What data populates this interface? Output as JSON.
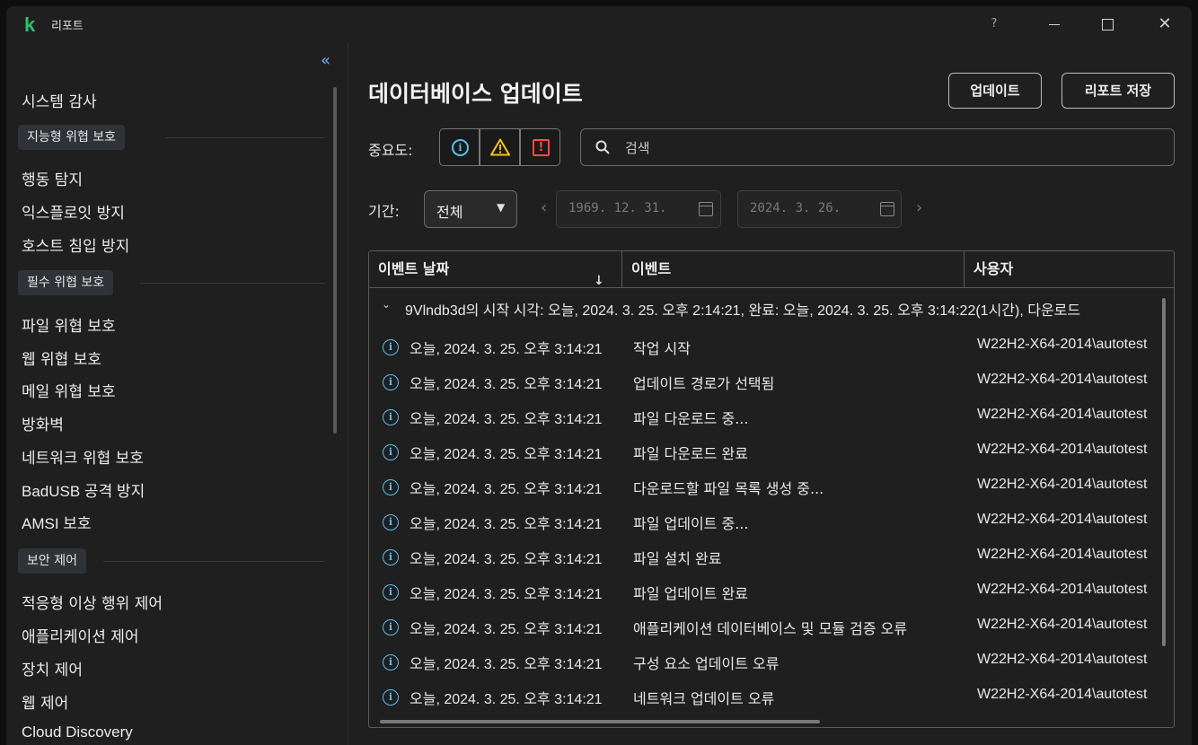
{
  "window": {
    "title": "리포트",
    "logo": "k",
    "help": "?",
    "close": "✕"
  },
  "sidebar": {
    "collapse": "«",
    "items_top": [
      "시스템 감사"
    ],
    "groups": [
      {
        "label": "지능형 위협 보호",
        "items": [
          "행동 탐지",
          "익스플로잇 방지",
          "호스트 침입 방지"
        ]
      },
      {
        "label": "필수 위협 보호",
        "items": [
          "파일 위협 보호",
          "웹 위협 보호",
          "메일 위협 보호",
          "방화벽",
          "네트워크 위협 보호",
          "BadUSB 공격 방지",
          "AMSI 보호"
        ]
      },
      {
        "label": "보안 제어",
        "items": [
          "적응형 이상 행위 제어",
          "애플리케이션 제어",
          "장치 제어",
          "웹 제어",
          "Cloud Discovery"
        ]
      }
    ]
  },
  "main": {
    "title": "데이터베이스 업데이트",
    "update_button": "업데이트",
    "save_button": "리포트 저장",
    "severity_label": "중요도:",
    "severity": {
      "info": "i",
      "critical": "!"
    },
    "search_placeholder": "검색",
    "period_label": "기간:",
    "period_value": "전체",
    "date_from": "1969. 12. 31.",
    "date_to": "2024. 3. 26.",
    "colors": {
      "accent": "#5bbcf0",
      "warning": "#f5c518",
      "critical": "#ff4a4a",
      "logo": "#2ec16e"
    }
  },
  "table": {
    "columns": [
      "이벤트 날짜",
      "이벤트",
      "사용자"
    ],
    "group": "9Vlndb3d의 시작 시각: 오늘, 2024. 3. 25. 오후 2:14:21, 완료: 오늘, 2024. 3. 25. 오후 3:14:22(1시간), 다운로드",
    "rows": [
      {
        "date": "오늘, 2024. 3. 25. 오후 3:14:21",
        "event": "작업 시작",
        "user": "W22H2-X64-2014\\autotest"
      },
      {
        "date": "오늘, 2024. 3. 25. 오후 3:14:21",
        "event": "업데이트 경로가 선택됨",
        "user": "W22H2-X64-2014\\autotest"
      },
      {
        "date": "오늘, 2024. 3. 25. 오후 3:14:21",
        "event": "파일 다운로드 중...",
        "user": "W22H2-X64-2014\\autotest"
      },
      {
        "date": "오늘, 2024. 3. 25. 오후 3:14:21",
        "event": "파일 다운로드 완료",
        "user": "W22H2-X64-2014\\autotest"
      },
      {
        "date": "오늘, 2024. 3. 25. 오후 3:14:21",
        "event": "다운로드할 파일 목록 생성 중...",
        "user": "W22H2-X64-2014\\autotest"
      },
      {
        "date": "오늘, 2024. 3. 25. 오후 3:14:21",
        "event": "파일 업데이트 중...",
        "user": "W22H2-X64-2014\\autotest"
      },
      {
        "date": "오늘, 2024. 3. 25. 오후 3:14:21",
        "event": "파일 설치 완료",
        "user": "W22H2-X64-2014\\autotest"
      },
      {
        "date": "오늘, 2024. 3. 25. 오후 3:14:21",
        "event": "파일 업데이트 완료",
        "user": "W22H2-X64-2014\\autotest"
      },
      {
        "date": "오늘, 2024. 3. 25. 오후 3:14:21",
        "event": "애플리케이션 데이터베이스 및 모듈 검증 오류",
        "user": "W22H2-X64-2014\\autotest"
      },
      {
        "date": "오늘, 2024. 3. 25. 오후 3:14:21",
        "event": "구성 요소 업데이트 오류",
        "user": "W22H2-X64-2014\\autotest"
      },
      {
        "date": "오늘, 2024. 3. 25. 오후 3:14:21",
        "event": "네트워크 업데이트 오류",
        "user": "W22H2-X64-2014\\autotest"
      }
    ]
  }
}
